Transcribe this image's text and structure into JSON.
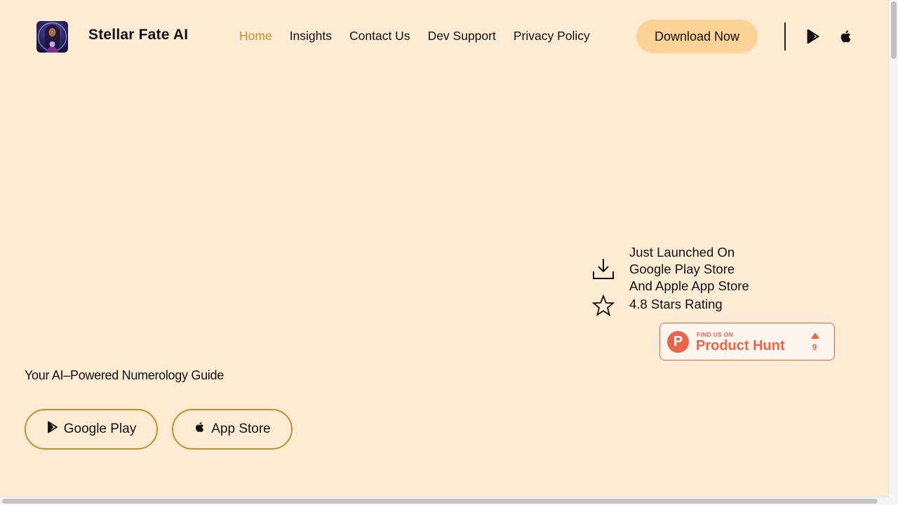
{
  "header": {
    "brand": "Stellar Fate AI",
    "logo_icon": "fortune-teller-avatar-icon",
    "nav": [
      {
        "label": "Home",
        "active": true
      },
      {
        "label": "Insights",
        "active": false
      },
      {
        "label": "Contact Us",
        "active": false
      },
      {
        "label": "Dev Support",
        "active": false
      },
      {
        "label": "Privacy Policy",
        "active": false
      }
    ],
    "download_label": "Download Now",
    "icons": [
      "google-play-icon",
      "apple-icon"
    ]
  },
  "info": {
    "launch_lines": [
      "Just Launched On",
      "Google Play Store",
      "And Apple App Store"
    ],
    "rating": "4.8 Stars Rating",
    "icons": [
      "download-icon",
      "star-icon"
    ]
  },
  "product_hunt": {
    "small": "FIND US ON",
    "big": "Product Hunt",
    "letter": "P",
    "upvotes": "9"
  },
  "hero": {
    "tagline": "Your AI–Powered Numerology Guide",
    "google_play_label": "Google Play",
    "app_store_label": "App Store"
  },
  "colors": {
    "background": "#fdebd3",
    "accent": "#c98c2a",
    "download_button": "#fcd397",
    "product_hunt": "#e8644a"
  }
}
